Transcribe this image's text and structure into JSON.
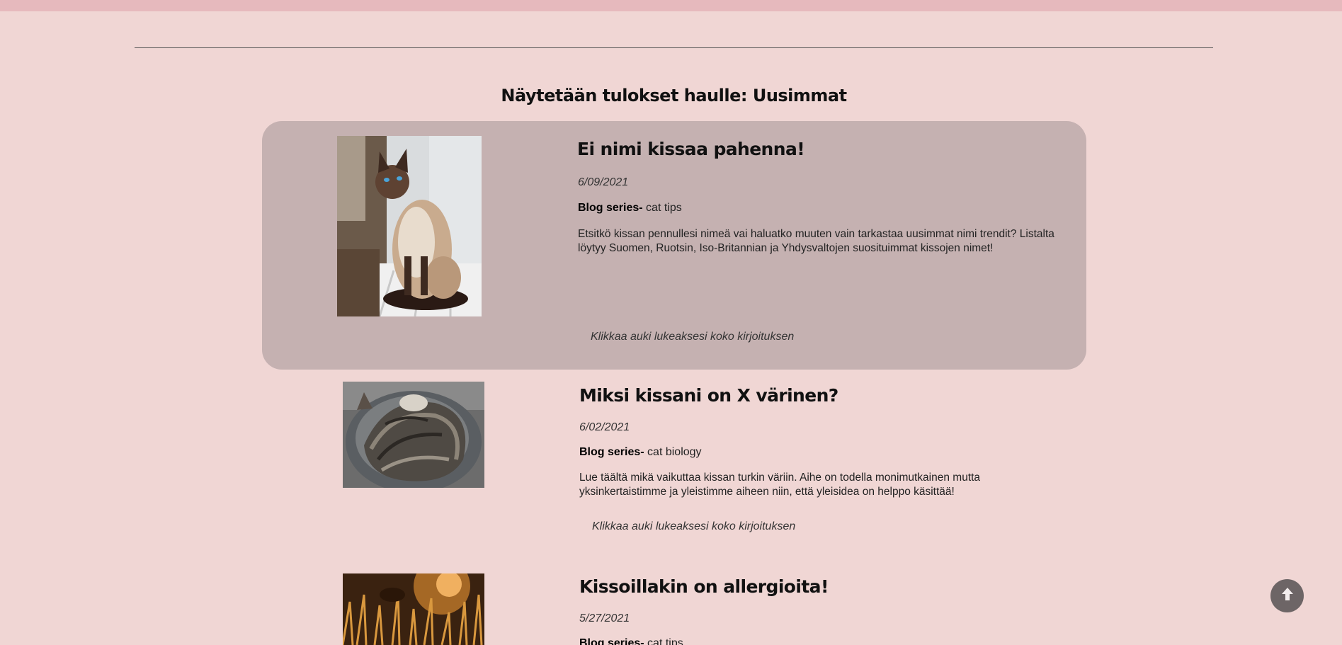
{
  "results_heading": "Näytetään tulokset haulle: Uusimmat",
  "series_label": "Blog series-",
  "read_more_label": "Klikkaa auki lukeaksesi koko kirjoituksen",
  "posts": [
    {
      "title": "Ei nimi kissaa pahenna!",
      "date": "6/09/2021",
      "series": "cat tips",
      "excerpt": "Etsitkö kissan pennullesi nimeä vai haluatko muuten vain tarkastaa uusimmat nimi trendit? Listalta löytyy Suomen, Ruotsin, Iso-Britannian ja Yhdysvaltojen suosituimmat kissojen nimet!"
    },
    {
      "title": "Miksi kissani on X värinen?",
      "date": "6/02/2021",
      "series": "cat biology",
      "excerpt": "Lue täältä mikä vaikuttaa kissan turkin väriin. Aihe on todella monimutkainen mutta yksinkertaistimme ja yleistimme aiheen niin, että yleisidea on helppo käsittää!"
    },
    {
      "title": "Kissoillakin on allergioita!",
      "date": "5/27/2021",
      "series": "cat tips"
    }
  ],
  "icons": {
    "scroll_top": "arrow-up-icon"
  },
  "colors": {
    "page_background": "#f0d6d4",
    "top_strip": "#e6b9bd",
    "highlight_card": "#c5b1b1",
    "scroll_button": "#6d6566"
  }
}
